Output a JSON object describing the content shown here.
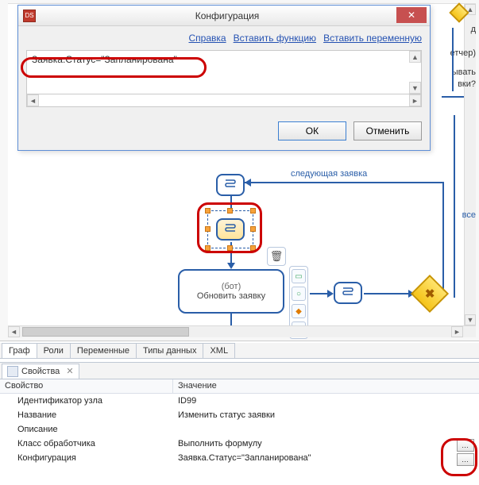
{
  "dialog": {
    "title": "Конфигурация",
    "links": {
      "help": "Справка",
      "insertFn": "Вставить функцию",
      "insertVar": "Вставить переменную"
    },
    "code": "Заявка.Статус=\"Запланирована\"",
    "ok": "ОК",
    "cancel": "Отменить"
  },
  "sidestrip": {
    "t1": "д",
    "t2": "етчер)",
    "t3": "ывать",
    "t4": "вки?",
    "t5": "все"
  },
  "workflow": {
    "labelNextRequest": "следующая заявка",
    "bot": {
      "caption": "(бот)",
      "title": "Обновить заявку"
    }
  },
  "tabs": [
    "Граф",
    "Роли",
    "Переменные",
    "Типы данных",
    "XML"
  ],
  "props": {
    "panelTitle": "Свойства",
    "col1": "Свойство",
    "col2": "Значение",
    "rows": [
      {
        "k": "Идентификатор узла",
        "v": "ID99"
      },
      {
        "k": "Название",
        "v": "Изменить статус заявки"
      },
      {
        "k": "Описание",
        "v": ""
      },
      {
        "k": "Класс обработчика",
        "v": "Выполнить формулу",
        "btn": true
      },
      {
        "k": "Конфигурация",
        "v": "Заявка.Статус=\"Запланирована\"",
        "btn": true
      }
    ]
  }
}
